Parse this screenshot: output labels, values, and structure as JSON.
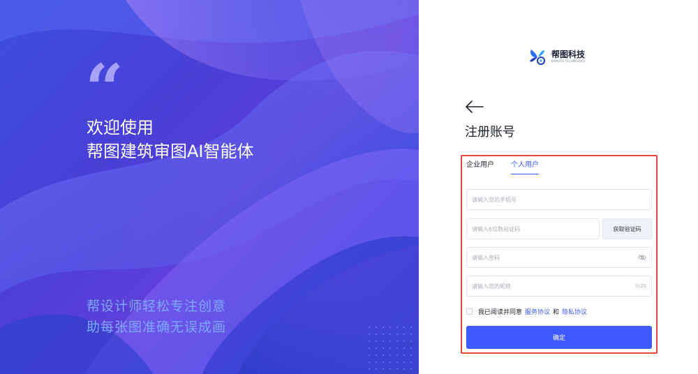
{
  "hero": {
    "title_line1": "欢迎使用",
    "title_line2": "帮图建筑审图AI智能体",
    "slogan_line1": "帮设计师轻松专注创意",
    "slogan_line2": "助每张图准确无误成画",
    "quote_icon": "quote-icon"
  },
  "brand": {
    "name": "帮图科技",
    "subtitle": "BANGTU TECHNOLOGY",
    "logo_icon": "butterfly-logo-icon"
  },
  "page": {
    "title": "注册账号",
    "back_icon": "arrow-left-icon"
  },
  "tabs": [
    {
      "label": "企业用户",
      "active": false
    },
    {
      "label": "个人用户",
      "active": true
    }
  ],
  "form": {
    "phone_placeholder": "请输入您的手机号",
    "code_placeholder": "请输入6位数验证码",
    "get_code_label": "获取验证码",
    "password_placeholder": "请输入密码",
    "nickname_placeholder": "请输入您的昵称",
    "nickname_counter": "0/20",
    "agree_text": "我已阅读并同意",
    "service_link": "服务协议",
    "and_text": "和",
    "privacy_link": "隐私协议",
    "submit_label": "确定"
  },
  "colors": {
    "accent": "#3d5afe",
    "highlight_border": "#e8453c",
    "hero_bg": "#4a3fd6",
    "slogan": "#7fa8ff"
  }
}
